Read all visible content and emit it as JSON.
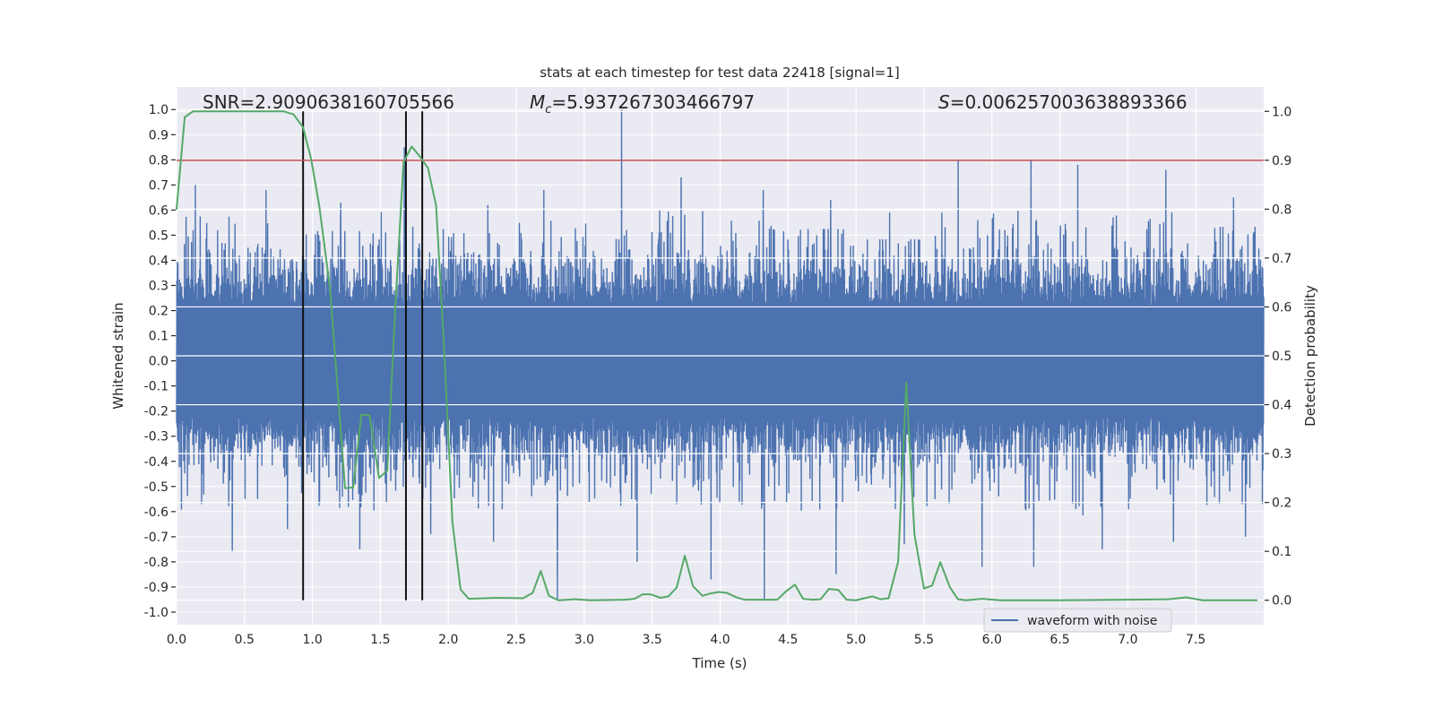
{
  "chart_data": {
    "type": "line",
    "title": "stats at each timestep for test data 22418 [signal=1]",
    "xlabel": "Time (s)",
    "ylabel_left": "Whitened strain",
    "ylabel_right": "Detection probability",
    "xlim": [
      0,
      8.0
    ],
    "ylim_left": [
      -1.05,
      1.09
    ],
    "ylim_right": [
      -0.05,
      1.05
    ],
    "xticks": [
      "0.0",
      "0.5",
      "1.0",
      "1.5",
      "2.0",
      "2.5",
      "3.0",
      "3.5",
      "4.0",
      "4.5",
      "5.0",
      "5.5",
      "6.0",
      "6.5",
      "7.0",
      "7.5"
    ],
    "yticks_left": [
      "1.0",
      "0.9",
      "0.8",
      "0.7",
      "0.6",
      "0.5",
      "0.4",
      "0.3",
      "0.2",
      "0.1",
      "0.0",
      "-0.1",
      "-0.2",
      "-0.3",
      "-0.4",
      "-0.5",
      "-0.6",
      "-0.7",
      "-0.8",
      "-0.9",
      "-1.0"
    ],
    "yticks_right": [
      "1.0",
      "0.9",
      "0.8",
      "0.7",
      "0.6",
      "0.5",
      "0.4",
      "0.3",
      "0.2",
      "0.1",
      "0.0"
    ],
    "grid": true,
    "legend": {
      "placement": "lower-right",
      "entries": [
        "waveform with noise"
      ]
    },
    "annotations": {
      "snr": "SNR=2.9090638160705566",
      "mc_symbol": "M",
      "mc_sub": "c",
      "mc_value": "=5.937267303466797",
      "s_symbol": "S",
      "s_value": "=0.006257003638893366"
    },
    "colors": {
      "waveform": "#4c72b0",
      "probability": "#55a868",
      "threshold": "#c44e52",
      "markers": "#111111",
      "background": "#eaeaf2"
    },
    "waveform": {
      "name": "waveform with noise",
      "axis": "left",
      "envelope_bins_s": [
        0,
        0.5,
        1.0,
        1.5,
        2.0,
        2.5,
        3.0,
        3.5,
        4.0,
        4.5,
        5.0,
        5.5,
        6.0,
        6.5,
        7.0,
        7.5
      ],
      "bin_max": [
        0.7,
        0.68,
        0.63,
        0.85,
        0.62,
        0.68,
        1.0,
        0.73,
        0.68,
        0.64,
        0.59,
        0.8,
        0.8,
        0.78,
        0.76,
        0.65
      ],
      "bin_min": [
        -0.76,
        -0.67,
        -0.75,
        -0.69,
        -0.72,
        -0.95,
        -0.8,
        -0.87,
        -0.95,
        -0.85,
        -0.73,
        -0.82,
        -0.82,
        -0.75,
        -0.72,
        -0.7
      ]
    },
    "detection_probability": {
      "axis": "right",
      "t": [
        0.0,
        0.06,
        0.12,
        0.79,
        0.86,
        0.93,
        0.99,
        1.05,
        1.13,
        1.24,
        1.3,
        1.36,
        1.42,
        1.49,
        1.55,
        1.61,
        1.67,
        1.73,
        1.79,
        1.85,
        1.91,
        1.97,
        2.03,
        2.09,
        2.15,
        2.36,
        2.55,
        2.62,
        2.68,
        2.74,
        2.81,
        2.93,
        3.05,
        3.3,
        3.37,
        3.43,
        3.49,
        3.56,
        3.62,
        3.68,
        3.74,
        3.8,
        3.87,
        3.93,
        3.99,
        4.05,
        4.12,
        4.18,
        4.42,
        4.48,
        4.55,
        4.61,
        4.68,
        4.74,
        4.8,
        4.87,
        4.93,
        5.0,
        5.12,
        5.18,
        5.24,
        5.31,
        5.37,
        5.43,
        5.5,
        5.56,
        5.62,
        5.69,
        5.75,
        5.81,
        5.93,
        6.06,
        6.5,
        7.0,
        7.3,
        7.43,
        7.55,
        7.95
      ],
      "p": [
        0.8,
        0.988,
        1.0,
        1.0,
        0.994,
        0.968,
        0.903,
        0.807,
        0.636,
        0.229,
        0.231,
        0.38,
        0.378,
        0.25,
        0.265,
        0.6,
        0.896,
        0.928,
        0.908,
        0.884,
        0.807,
        0.51,
        0.16,
        0.022,
        0.003,
        0.005,
        0.004,
        0.015,
        0.06,
        0.009,
        0.0,
        0.002,
        0.0,
        0.001,
        0.003,
        0.012,
        0.012,
        0.005,
        0.008,
        0.026,
        0.091,
        0.029,
        0.009,
        0.014,
        0.017,
        0.015,
        0.006,
        0.001,
        0.001,
        0.017,
        0.032,
        0.003,
        0.001,
        0.002,
        0.023,
        0.021,
        0.001,
        0.0,
        0.008,
        0.002,
        0.004,
        0.079,
        0.446,
        0.134,
        0.024,
        0.03,
        0.078,
        0.027,
        0.002,
        0.0,
        0.003,
        0.0,
        0.0,
        0.001,
        0.002,
        0.006,
        0.0,
        0.0
      ]
    },
    "threshold": {
      "axis": "right",
      "value": 0.9
    },
    "marker_times": [
      0.931,
      1.688,
      1.808
    ],
    "marker_span_right": [
      0.0,
      1.0
    ]
  }
}
